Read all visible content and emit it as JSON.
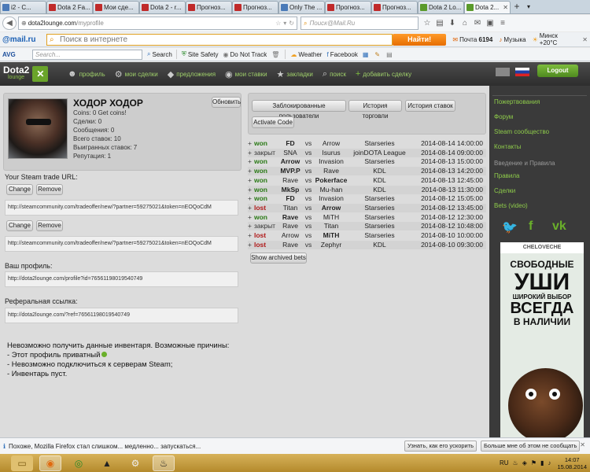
{
  "tabs": [
    {
      "label": "i2 - C...",
      "color": "#4a7ab8",
      "active": false
    },
    {
      "label": "Dota 2 Fa...",
      "color": "#c02a2a",
      "active": false
    },
    {
      "label": "Мои сде...",
      "color": "#c02a2a",
      "active": false
    },
    {
      "label": "Dota 2 - r...",
      "color": "#c02a2a",
      "active": false
    },
    {
      "label": "Прогноз...",
      "color": "#c02a2a",
      "active": false
    },
    {
      "label": "Прогноз...",
      "color": "#c02a2a",
      "active": false
    },
    {
      "label": "Only The ...",
      "color": "#4a7ab8",
      "active": false
    },
    {
      "label": "Прогноз...",
      "color": "#c02a2a",
      "active": false
    },
    {
      "label": "Прогноз...",
      "color": "#c02a2a",
      "active": false
    },
    {
      "label": "Dota 2 Lo...",
      "color": "#5a9a2a",
      "active": false
    },
    {
      "label": "Dota 2...",
      "color": "#5a9a2a",
      "active": true
    }
  ],
  "browser": {
    "url_host": "dota2lounge.com",
    "url_path": "/myprofile",
    "search_placeholder": "Поиск@Mail.Ru"
  },
  "mailbar": {
    "logo": "@mail.ru",
    "search_placeholder": "Поиск в интернете",
    "find_label": "Найти!",
    "mail_label": "Почта",
    "mail_count": "6194",
    "music_label": "Музыка",
    "weather_label": "Минск +20°C"
  },
  "avgbar": {
    "logo": "AVG",
    "search_placeholder": "Search...",
    "search_label": "Search",
    "site_safety": "Site Safety",
    "do_not_track": "Do Not Track",
    "weather": "Weather",
    "facebook": "Facebook"
  },
  "site": {
    "logo_text": "Dota2",
    "logo_sub": "lounge",
    "nav": [
      {
        "icon": "user-icon",
        "glyph": "☻",
        "label": "профиль"
      },
      {
        "icon": "deals-icon",
        "glyph": "⚙",
        "label": "мои сделки"
      },
      {
        "icon": "offers-icon",
        "glyph": "◆",
        "label": "предложения"
      },
      {
        "icon": "bets-icon",
        "glyph": "◉",
        "label": "мои ставки"
      },
      {
        "icon": "bookmark-icon",
        "glyph": "★",
        "label": "закладки"
      },
      {
        "icon": "search-icon",
        "glyph": "⌕",
        "label": "поиск"
      },
      {
        "icon": "add-icon",
        "glyph": "+",
        "label": "добавить сделку"
      }
    ],
    "logout": "Logout"
  },
  "profile": {
    "name": "ХОДОР ХОДОР",
    "coins": "Coins: 0 Get coins!",
    "deals": "Сделки: 0",
    "messages": "Сообщения: 0",
    "total_bets": "Всего ставок: 10",
    "won_bets": "Выигранных ставок: 7",
    "reputation": "Репутация: 1",
    "update_btn": "Обновить"
  },
  "trade": {
    "label": "Your Steam trade URL:",
    "change": "Change",
    "remove": "Remove",
    "url1": "http://steamcommunity.com/tradeoffer/new/?partner=59275021&token=nEOQoCdM",
    "url2": "http://steamcommunity.com/tradeoffer/new/?partner=59275021&token=nEOQoCdM"
  },
  "profile_link": {
    "label": "Ваш профиль:",
    "url": "http://dota2lounge.com/profile?id=76561198019540749"
  },
  "ref_link": {
    "label": "Реферальная ссылка:",
    "url": "http://dota2lounge.com/?ref=76561198019540749"
  },
  "inventory_error": {
    "line1": "Невозможно получить данные инвентаря. Возможные причины:",
    "line2": "- Этот профиль приватный",
    "line3": "- Невозможно подключиться к серверам Steam;",
    "line4": "- Инвентарь пуст."
  },
  "actions": {
    "blocked_users": "Заблокированные пользователи",
    "trade_history": "История торговли",
    "bet_history": "История ставок",
    "activate_code": "Activate Code",
    "show_archived": "Show archived bets"
  },
  "bets": [
    {
      "status": "won",
      "team1": "FD",
      "team2": "Arrow",
      "league": "Starseries",
      "date": "2014-08-14 14:00:00",
      "bold": 1
    },
    {
      "status": "закрыт",
      "team1": "SNA",
      "team2": "Isurus",
      "league": "joinDOTA League",
      "date": "2014-08-14 09:00:00",
      "bold": 0
    },
    {
      "status": "won",
      "team1": "Arrow",
      "team2": "Invasion",
      "league": "Starseries",
      "date": "2014-08-13 15:00:00",
      "bold": 1
    },
    {
      "status": "won",
      "team1": "MVP.P",
      "team2": "Rave",
      "league": "KDL",
      "date": "2014-08-13 14:20:00",
      "bold": 1
    },
    {
      "status": "won",
      "team1": "Rave",
      "team2": "Pokerface",
      "league": "KDL",
      "date": "2014-08-13 12:45:00",
      "bold": 2
    },
    {
      "status": "won",
      "team1": "MkSp",
      "team2": "Mu-han",
      "league": "KDL",
      "date": "2014-08-13 11:30:00",
      "bold": 1
    },
    {
      "status": "won",
      "team1": "FD",
      "team2": "Invasion",
      "league": "Starseries",
      "date": "2014-08-12 15:05:00",
      "bold": 1
    },
    {
      "status": "lost",
      "team1": "Titan",
      "team2": "Arrow",
      "league": "Starseries",
      "date": "2014-08-12 13:45:00",
      "bold": 2
    },
    {
      "status": "won",
      "team1": "Rave",
      "team2": "MiTH",
      "league": "Starseries",
      "date": "2014-08-12 12:30:00",
      "bold": 1
    },
    {
      "status": "закрыт",
      "team1": "Rave",
      "team2": "Titan",
      "league": "Starseries",
      "date": "2014-08-12 10:48:00",
      "bold": 0
    },
    {
      "status": "lost",
      "team1": "Arrow",
      "team2": "MiTH",
      "league": "Starseries",
      "date": "2014-08-10 10:00:00",
      "bold": 2
    },
    {
      "status": "lost",
      "team1": "Rave",
      "team2": "Zephyr",
      "league": "KDL",
      "date": "2014-08-10 09:30:00",
      "bold": 0
    }
  ],
  "sidebar": {
    "links1": [
      "Пожертвования",
      "Форум",
      "Steam сообщество",
      "Контакты"
    ],
    "heading": "Введение и Правила",
    "links2": [
      "Правила",
      "Сделки",
      "Bets (video)"
    ],
    "ad_brand": "CHELOVECHE",
    "ad_line1": "СВОБОДНЫЕ",
    "ad_line2": "УШИ",
    "ad_line3": "ШИРОКИЙ ВЫБОР",
    "ad_line4": "ВСЕГДА",
    "ad_line5": "В НАЛИЧИИ"
  },
  "notification": {
    "text": "Похоже, Mozilla Firefox стал слишком... медленно... запускаться...",
    "btn1": "Узнать, как его ускорить",
    "btn2": "Больше мне об этом не сообщать"
  },
  "taskbar": {
    "lang": "RU",
    "time": "14:07",
    "date": "15.08.2014"
  }
}
